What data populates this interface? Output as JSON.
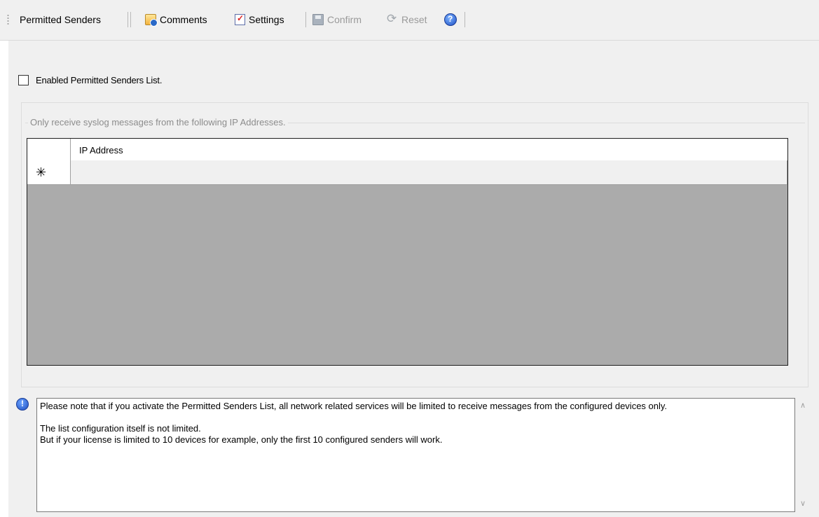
{
  "toolbar": {
    "title": "Permitted Senders",
    "comments_label": "Comments",
    "settings_label": "Settings",
    "confirm_label": "Confirm",
    "reset_label": "Reset",
    "icons": {
      "comments": "comments-icon",
      "settings": "settings-icon",
      "confirm": "save-icon",
      "reset": "reset-icon",
      "help": "help-icon"
    }
  },
  "options": {
    "enable_label": "Enabled Permitted Senders List.",
    "enable_checked": false
  },
  "group": {
    "legend": "Only receive syslog messages from the following IP Addresses.",
    "grid": {
      "columns": [
        "IP Address"
      ],
      "rows": [],
      "new_row_marker": "✳"
    }
  },
  "info": {
    "line1": "Please note that if you activate the Permitted Senders List, all network related services will be limited to receive messages from the configured devices only.",
    "line2": "The list configuration itself is not limited.",
    "line3": "But if your license is limited to 10 devices for example, only the first 10 configured senders will work."
  },
  "colors": {
    "panel_bg": "#f0f0f0",
    "grid_empty": "#ababab",
    "disabled_text": "#9a9a9a"
  }
}
